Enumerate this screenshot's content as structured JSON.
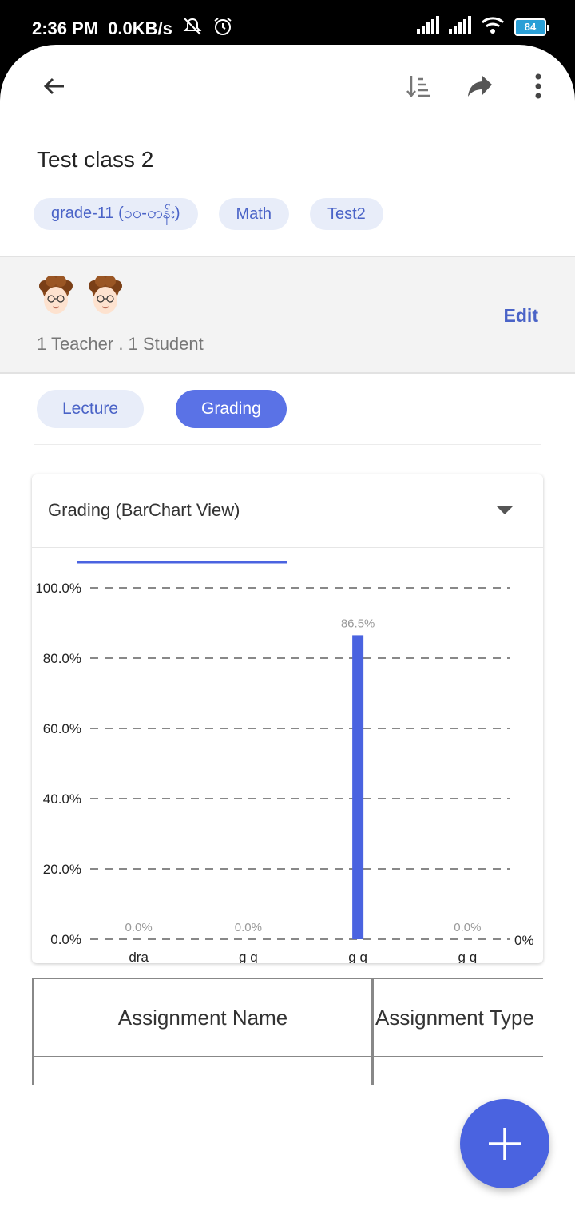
{
  "status_bar": {
    "time": "2:36 PM",
    "net_speed": "0.0KB/s",
    "battery": "84",
    "icons": [
      "mute-icon",
      "alarm-icon",
      "signal-icon",
      "signal-icon",
      "wifi-icon",
      "battery-icon"
    ]
  },
  "toolbar": {
    "icons": [
      "back-arrow-icon",
      "sort-icon",
      "share-icon",
      "more-vert-icon"
    ]
  },
  "class_info": {
    "title": "Test class 2",
    "chips": [
      "grade-11 (၁၀-တန်း)",
      "Math",
      "Test2"
    ]
  },
  "members": {
    "summary": "1 Teacher . 1 Student",
    "edit_label": "Edit"
  },
  "tabs": [
    {
      "label": "Lecture",
      "active": false
    },
    {
      "label": "Grading",
      "active": true
    }
  ],
  "grading_card": {
    "title": "Grading (BarChart View)"
  },
  "chart_data": {
    "type": "bar",
    "categories": [
      "dra",
      "g q",
      "g q",
      "g q"
    ],
    "values": [
      0.0,
      0.0,
      86.5,
      0.0
    ],
    "value_labels": [
      "0.0%",
      "0.0%",
      "86.5%",
      "0.0%"
    ],
    "y_ticks": [
      "0.0%",
      "20.0%",
      "40.0%",
      "60.0%",
      "80.0%",
      "100.0%"
    ],
    "right_label": "0%",
    "ylim": [
      0,
      100
    ],
    "grid": true,
    "bar_color": "#4a63e0"
  },
  "table": {
    "headers": [
      "Assignment Name",
      "Assignment Type"
    ]
  },
  "colors": {
    "accent": "#4a63e0",
    "chip_bg": "#e8edf9",
    "chip_text": "#4a63c7"
  }
}
